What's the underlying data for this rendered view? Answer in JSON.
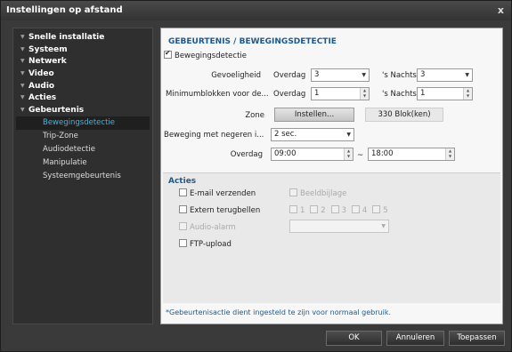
{
  "window": {
    "title": "Instellingen op afstand",
    "close_label": "x"
  },
  "sidebar": {
    "items": [
      {
        "label": "Snelle installatie"
      },
      {
        "label": "Systeem"
      },
      {
        "label": "Netwerk"
      },
      {
        "label": "Video"
      },
      {
        "label": "Audio"
      },
      {
        "label": "Acties"
      },
      {
        "label": "Gebeurtenis"
      }
    ],
    "sub_items": [
      {
        "label": "Bewegingsdetectie",
        "active": true
      },
      {
        "label": "Trip-Zone"
      },
      {
        "label": "Audiodetectie"
      },
      {
        "label": "Manipulatie"
      },
      {
        "label": "Systeemgebeurtenis"
      }
    ]
  },
  "main": {
    "title": "GEBEURTENIS / BEWEGINGSDETECTIE",
    "motion_checkbox_label": "Bewegingsdetectie",
    "sensitivity": {
      "label": "Gevoeligheid",
      "day_label": "Overdag",
      "day_value": "3",
      "night_label": "'s Nachts",
      "night_value": "3"
    },
    "min_blocks": {
      "label": "Minimumblokken voor de...",
      "day_label": "Overdag",
      "day_value": "1",
      "night_label": "'s Nachts",
      "night_value": "1"
    },
    "zone": {
      "label": "Zone",
      "button_label": "Instellen...",
      "blocks_text": "330 Blok(ken)"
    },
    "ignore": {
      "label": "Beweging met negeren i...",
      "value": "2 sec."
    },
    "daytime": {
      "label": "Overdag",
      "start": "09:00",
      "separator": "~",
      "end": "18:00"
    },
    "actions": {
      "title": "Acties",
      "email_label": "E-mail verzenden",
      "image_attach_label": "Beeldbijlage",
      "callback_label": "Extern terugbellen",
      "callback_numbers": [
        "1",
        "2",
        "3",
        "4",
        "5"
      ],
      "audio_alarm_label": "Audio-alarm",
      "ftp_label": "FTP-upload"
    },
    "footer_note": "*Gebeurtenisactie dient ingesteld te zijn voor normaal gebruik."
  },
  "buttons": {
    "ok": "OK",
    "cancel": "Annuleren",
    "apply": "Toepassen"
  }
}
